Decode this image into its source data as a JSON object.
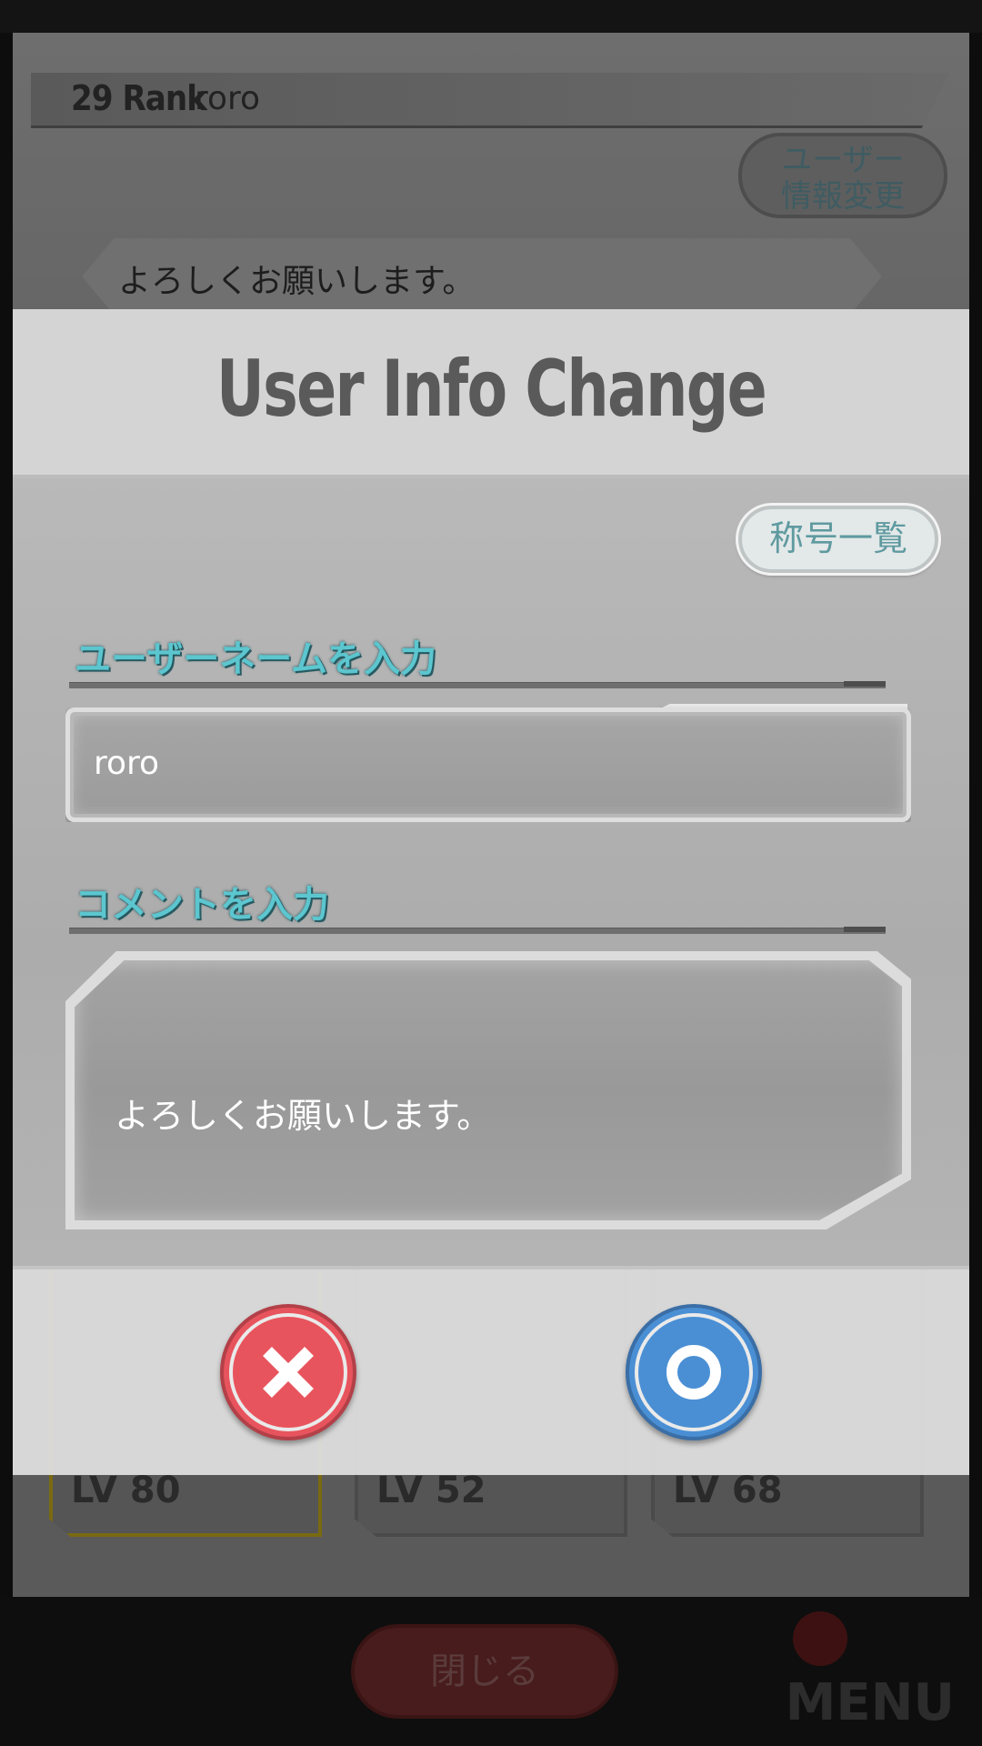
{
  "background": {
    "rank_text": "29 Rank",
    "player_name": "roro",
    "user_info_button": "ユーザー\n情報変更",
    "comment_bubble": "よろしくお願いします。",
    "cards": [
      {
        "level": "LV 80"
      },
      {
        "level": "LV 52"
      },
      {
        "level": "LV 68"
      }
    ],
    "close_button": "閉じる",
    "menu_label": "MENU"
  },
  "dialog": {
    "title": "User Info Change",
    "titles_button": "称号一覧",
    "username_label": "ユーザーネームを入力",
    "username_value": "roro",
    "comment_label": "コメントを入力",
    "comment_value": "よろしくお願いします。",
    "cancel_icon": "close-icon",
    "ok_icon": "circle-ok-icon"
  },
  "colors": {
    "accent_cyan": "#5cc6cf",
    "cancel_red": "#e8545d",
    "ok_blue": "#4a8fd4"
  }
}
